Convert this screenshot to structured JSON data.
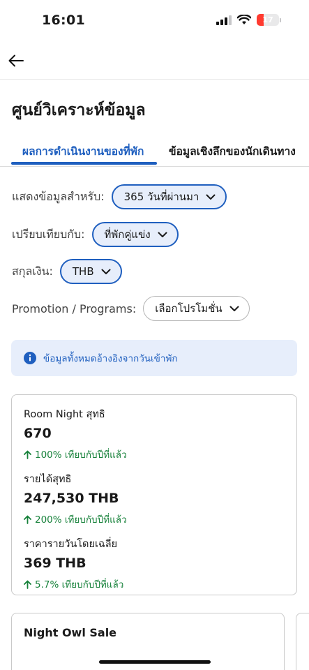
{
  "status": {
    "time": "16:01",
    "battery": "17",
    "battery_level": 0.17
  },
  "header": {
    "title": "ศูนย์วิเคราะห์ข้อมูล"
  },
  "tabs": [
    {
      "label": "ผลการดำเนินงานของที่พัก",
      "active": true
    },
    {
      "label": "ข้อมูลเชิงลึกของนักเดินทาง",
      "active": false
    }
  ],
  "filters": {
    "period": {
      "label": "แสดงข้อมูลสำหรับ:",
      "value": "365 วันที่ผ่านมา"
    },
    "compare": {
      "label": "เปรียบเทียบกับ:",
      "value": "ที่พักคู่แข่ง"
    },
    "currency": {
      "label": "สกุลเงิน:",
      "value": "THB"
    },
    "promotion": {
      "label": "Promotion / Programs:",
      "value": "เลือกโปรโมชั่น"
    }
  },
  "info": {
    "text": "ข้อมูลทั้งหมดอ้างอิงจากวันเข้าพัก"
  },
  "metrics": [
    {
      "label": "Room Night สุทธิ",
      "value": "670",
      "change": "100% เทียบกับปีที่แล้ว"
    },
    {
      "label": "รายได้สุทธิ",
      "value": "247,530 THB",
      "change": "200% เทียบกับปีที่แล้ว"
    },
    {
      "label": "ราคารายวันโดยเฉลี่ย",
      "value": "369 THB",
      "change": "5.7% เทียบกับปีที่แล้ว"
    }
  ],
  "promo_card": {
    "title": "Night Owl Sale"
  },
  "colors": {
    "accent": "#1f5fbf",
    "accent_bg": "#e7eefb",
    "positive": "#16813a",
    "battery_low": "#ff3b30"
  }
}
